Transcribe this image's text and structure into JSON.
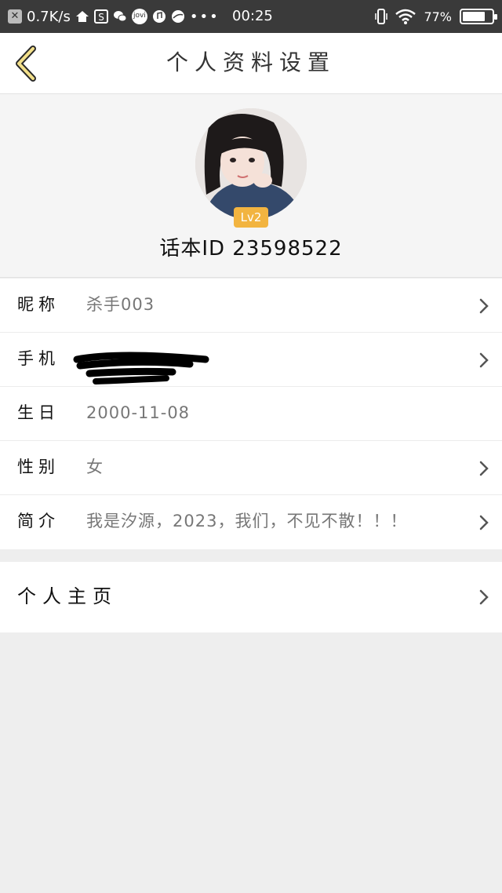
{
  "status_bar": {
    "speed": "0.7K/s",
    "time": "00:25",
    "battery": "77%",
    "battery_level": 0.77
  },
  "header": {
    "title": "个人资料设置"
  },
  "profile": {
    "level": "Lv2",
    "user_id": "话本ID 23598522"
  },
  "rows": [
    {
      "label": "昵称",
      "value": "杀手003"
    },
    {
      "label": "手机",
      "value": ""
    },
    {
      "label": "生日",
      "value": "2000-11-08"
    },
    {
      "label": "性别",
      "value": "女"
    },
    {
      "label": "简介",
      "value": "我是汐源，2023，我们，不见不散！！！"
    }
  ],
  "homepage": {
    "label": "个人主页"
  }
}
